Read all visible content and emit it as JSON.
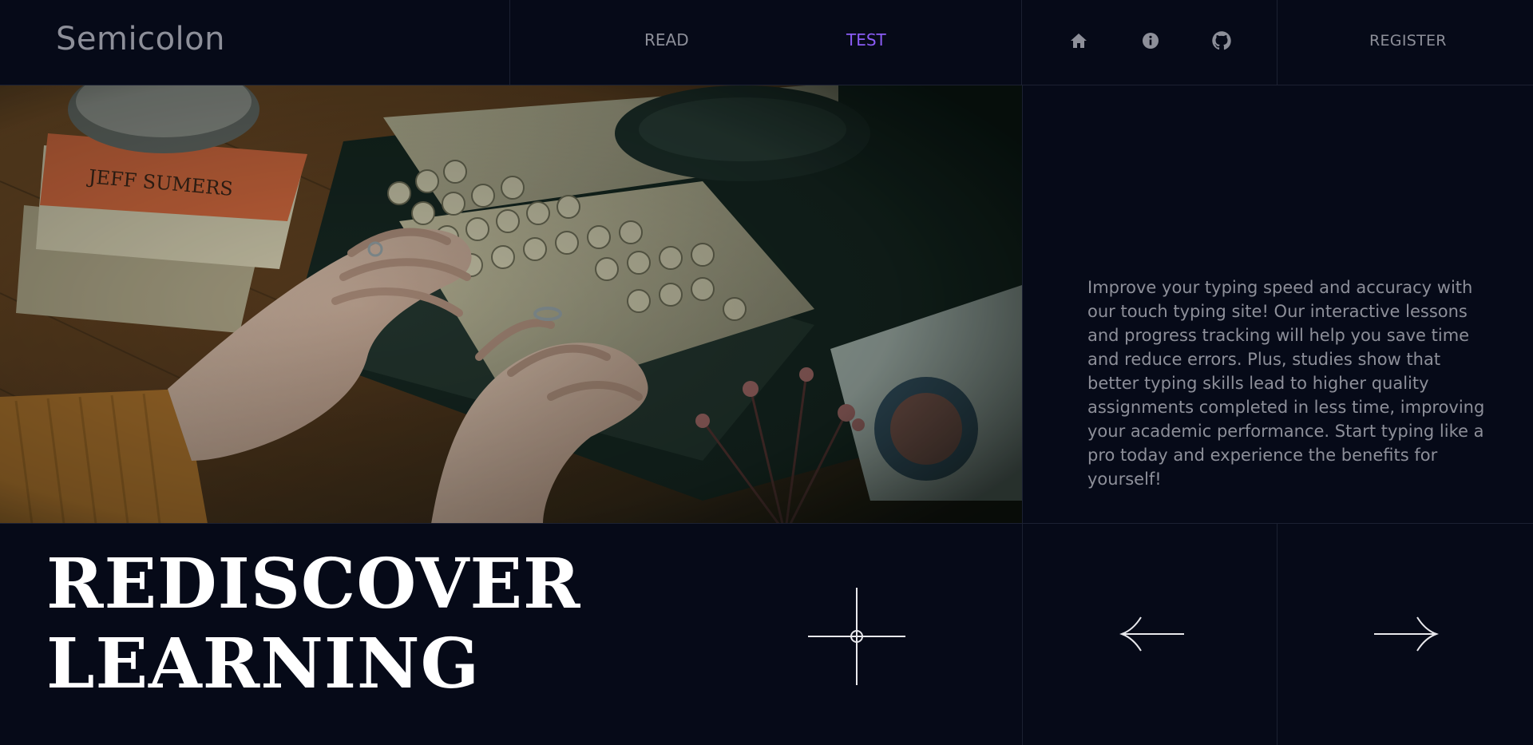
{
  "header": {
    "brand": "Semicolon",
    "nav": {
      "read": "READ",
      "test": "TEST"
    },
    "icons": [
      "home-icon",
      "info-icon",
      "github-icon"
    ],
    "register": "REGISTER"
  },
  "hero": {
    "image_alt": "Hands typing on a vintage typewriter beside books and dried flowers",
    "description": "Improve your typing speed and accuracy with our touch typing site! Our interactive lessons and progress tracking will help you save time and reduce errors. Plus, studies show that better typing skills lead to higher quality assignments completed in less time, improving your academic performance. Start typing like a pro today and experience the benefits for yourself!"
  },
  "headline": {
    "line1": "REDISCOVER",
    "line2": "LEARNING"
  },
  "controls": {
    "prev_icon": "arrow-left-icon",
    "next_icon": "arrow-right-icon",
    "sparkle_icon": "sparkle-icon"
  },
  "colors": {
    "background": "#060a18",
    "muted_text": "#8d8f99",
    "accent": "#8b5cf6",
    "divider": "#1c2132",
    "headline": "#ffffff"
  }
}
